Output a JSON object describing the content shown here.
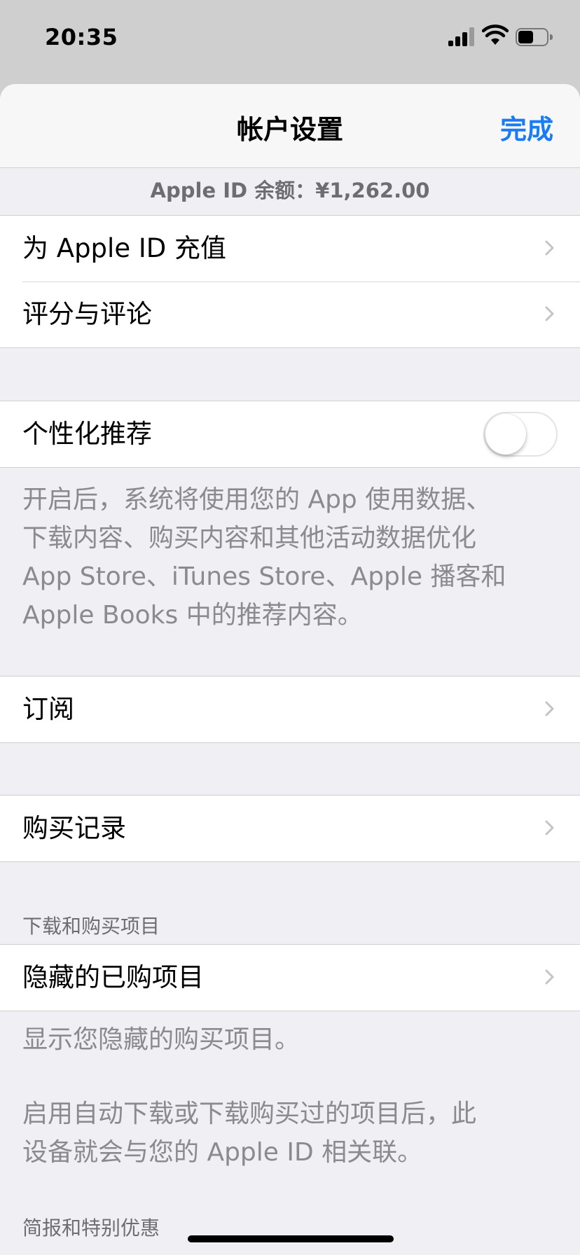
{
  "status_bar": {
    "time": "20:35",
    "icons": [
      "cellular-signal-icon",
      "wifi-icon",
      "battery-icon"
    ]
  },
  "nav": {
    "title": "帐户设置",
    "done_label": "完成"
  },
  "balance_text": "Apple ID 余额：¥1,262.00",
  "rows": {
    "add_funds": "为 Apple ID 充值",
    "ratings": "评分与评论",
    "personalized": "个性化推荐",
    "subscriptions": "订阅",
    "purchase_history": "购买记录",
    "hidden_purchases": "隐藏的已购项目"
  },
  "personalized_toggle_on": false,
  "personalized_footer": [
    "开启后，系统将使用您的 App 使用数据、",
    "下载内容、购买内容和其他活动数据优化",
    "App Store、iTunes Store、Apple 播客和",
    "Apple Books 中的推荐内容。"
  ],
  "sections": {
    "downloads_header": "下载和购买项目",
    "newsletter_header": "简报和特别优惠"
  },
  "hidden_footer_1": "显示您隐藏的购买项目。",
  "hidden_footer_2": [
    "启用自动下载或下载购买过的项目后，此",
    "设备就会与您的 Apple ID 相关联。"
  ],
  "colors": {
    "accent": "#1a7cf5",
    "background": "#efeff4",
    "secondary_text": "#8a8a8f"
  }
}
